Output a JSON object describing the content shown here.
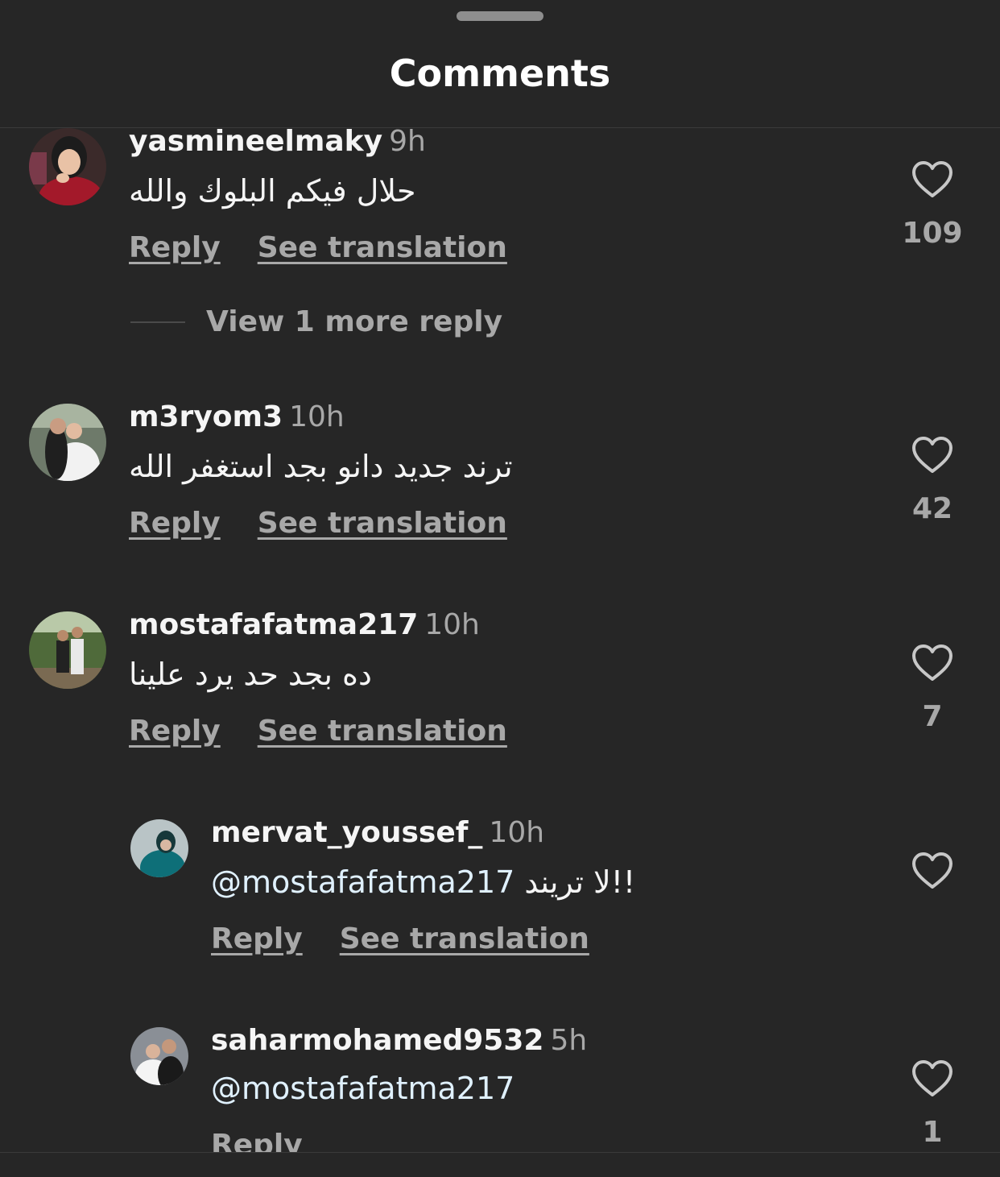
{
  "header": {
    "title": "Comments"
  },
  "actions": {
    "reply": "Reply",
    "see_translation": "See translation"
  },
  "comments": [
    {
      "username": "yasmineelmaky",
      "time": "9h",
      "text": "حلال فيكم البلوك والله",
      "likes": "109",
      "view_more": "View 1 more reply"
    },
    {
      "username": "m3ryom3",
      "time": "10h",
      "text": "ترند جديد دانو بجد استغفر الله",
      "likes": "42"
    },
    {
      "username": "mostafafatma217",
      "time": "10h",
      "text": "ده بجد حد يرد علينا",
      "likes": "7"
    }
  ],
  "replies": [
    {
      "username": "mervat_youssef_",
      "time": "10h",
      "mention": "@mostafafatma217",
      "text": "!!لا تريند",
      "likes": ""
    },
    {
      "username": "saharmohamed9532",
      "time": "5h",
      "mention": "@mostafafatma217",
      "text": "",
      "likes": "1"
    }
  ]
}
